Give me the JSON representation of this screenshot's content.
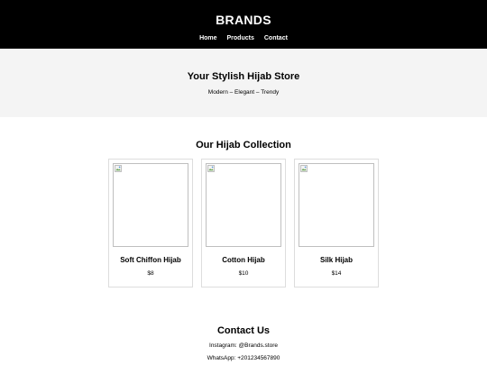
{
  "header": {
    "brand": "BRANDS",
    "nav": [
      "Home",
      "Products",
      "Contact"
    ]
  },
  "hero": {
    "title": "Your Stylish Hijab Store",
    "tagline": "Modern – Elegant – Trendy"
  },
  "collection": {
    "title": "Our Hijab Collection",
    "products": [
      {
        "name": "Soft Chiffon Hijab",
        "price": "$8"
      },
      {
        "name": "Cotton Hijab",
        "price": "$10"
      },
      {
        "name": "Silk Hijab",
        "price": "$14"
      }
    ]
  },
  "contact": {
    "title": "Contact Us",
    "instagram": "Instagram: @Brands.store",
    "whatsapp": "WhatsApp: +201234567890"
  },
  "colors": {
    "header_bg": "#000000",
    "hero_bg": "#f4f4f4",
    "card_border": "#dddddd"
  },
  "icons": {
    "product_image": "broken-image-icon"
  }
}
